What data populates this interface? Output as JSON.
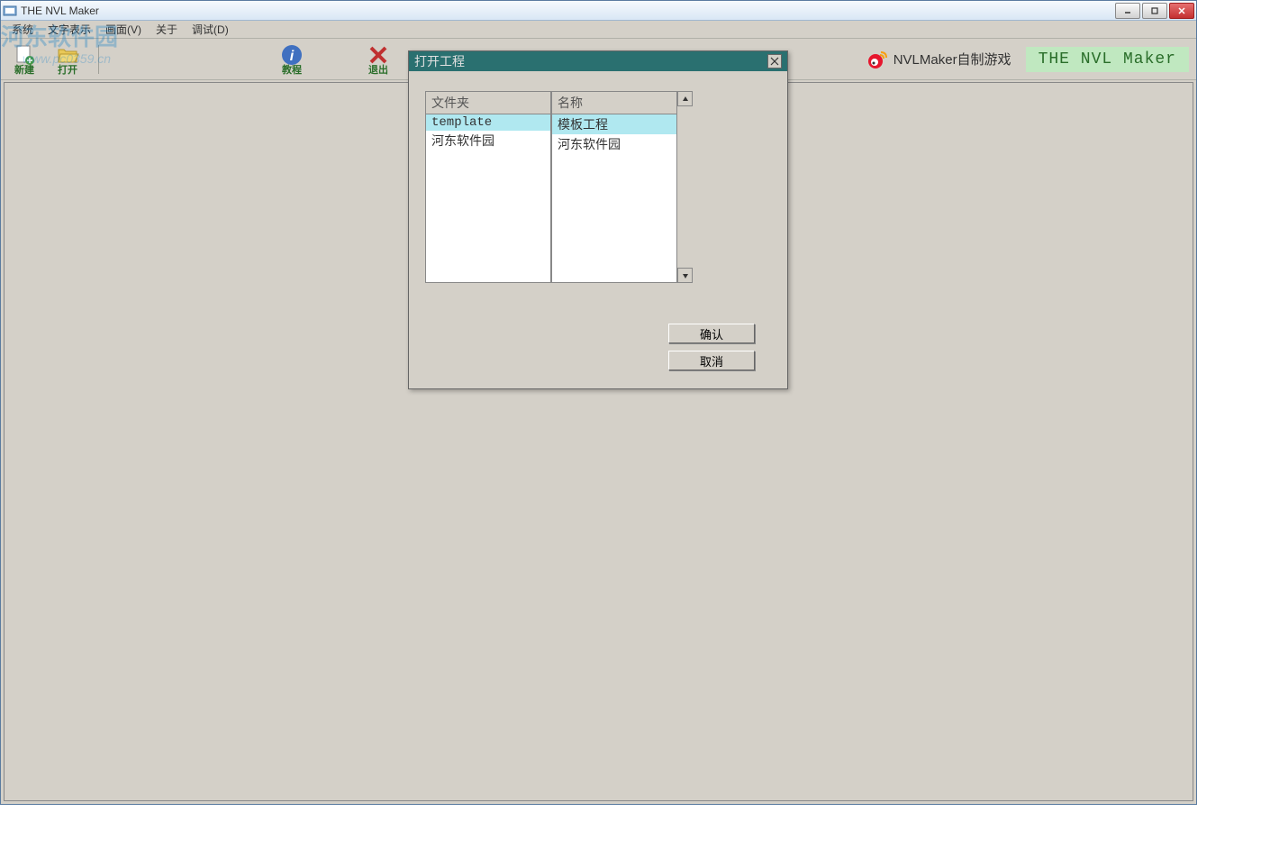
{
  "window": {
    "title": "THE NVL Maker"
  },
  "menu": {
    "items": [
      "系统",
      "文字表示",
      "画面(V)",
      "关于",
      "调试(D)"
    ]
  },
  "toolbar": {
    "new_label": "新建",
    "open_label": "打开",
    "tutorial_label": "教程",
    "exit_label": "退出",
    "weibo_label": "NVLMaker自制游戏",
    "brand_label": "THE NVL Maker"
  },
  "watermark": {
    "main": "河东软件园",
    "sub": "www.pc0359.cn"
  },
  "dialog": {
    "title": "打开工程",
    "columns": {
      "folder": "文件夹",
      "name": "名称"
    },
    "rows": [
      {
        "folder": "template",
        "name": "模板工程",
        "selected": true
      },
      {
        "folder": "河东软件园",
        "name": "河东软件园",
        "selected": false
      }
    ],
    "ok_label": "确认",
    "cancel_label": "取消"
  }
}
